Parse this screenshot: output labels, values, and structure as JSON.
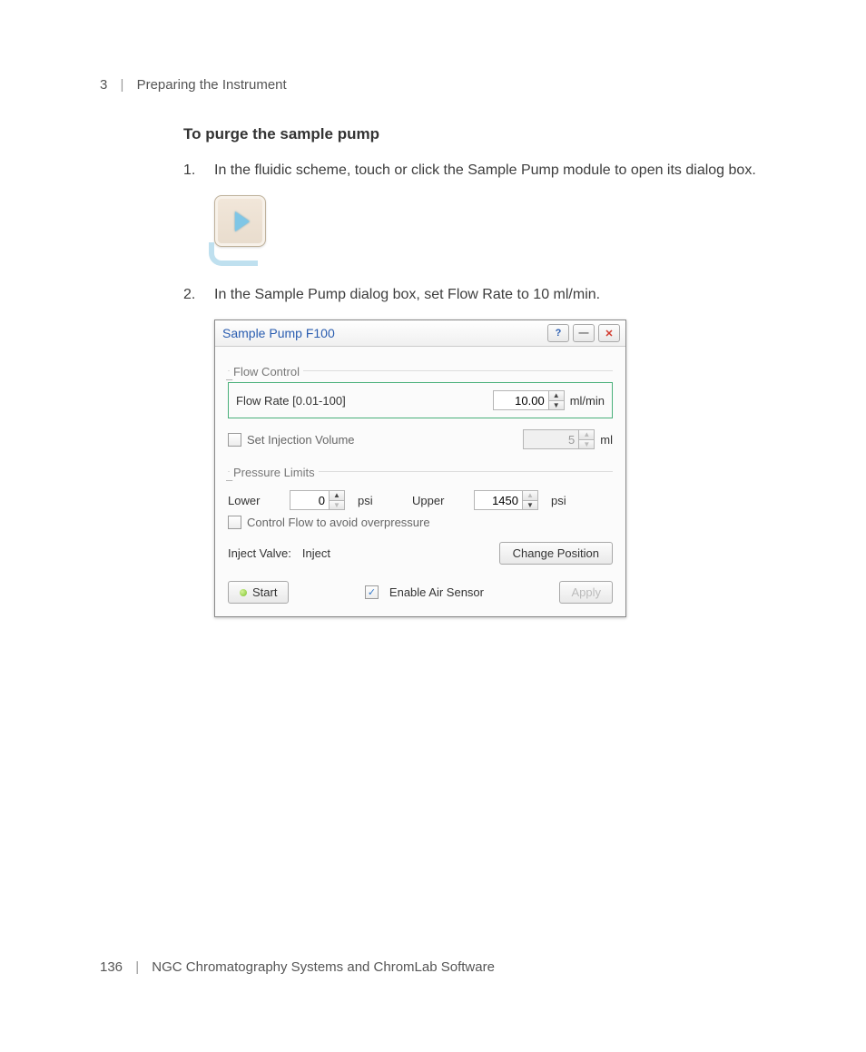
{
  "header": {
    "chapter_num": "3",
    "chapter_title": "Preparing the Instrument"
  },
  "section_title": "To purge the sample pump",
  "steps": {
    "s1_num": "1.",
    "s1_text": "In the fluidic scheme, touch or click the Sample Pump module to open its dialog box.",
    "s2_num": "2.",
    "s2_text": "In the Sample Pump dialog box, set Flow Rate to 10 ml/min."
  },
  "dialog": {
    "title": "Sample Pump F100",
    "help_symbol": "?",
    "min_symbol": "—",
    "close_symbol": "✕",
    "flow_control": {
      "group_label": "Flow Control",
      "flow_rate_label": "Flow Rate [0.01-100]",
      "flow_rate_value": "10.00",
      "flow_rate_unit": "ml/min",
      "set_inj_label": "Set Injection Volume",
      "set_inj_value": "5",
      "set_inj_unit": "ml"
    },
    "pressure": {
      "group_label": "Pressure Limits",
      "lower_label": "Lower",
      "lower_value": "0",
      "lower_unit": "psi",
      "upper_label": "Upper",
      "upper_value": "1450",
      "upper_unit": "psi",
      "control_flow_label": "Control Flow to avoid overpressure"
    },
    "inject": {
      "label": "Inject Valve:",
      "value": "Inject",
      "change_btn": "Change Position"
    },
    "bottom": {
      "start_btn": "Start",
      "air_sensor_label": "Enable Air Sensor",
      "apply_btn": "Apply"
    }
  },
  "footer": {
    "page_num": "136",
    "doc_title": "NGC Chromatography Systems and ChromLab Software"
  }
}
